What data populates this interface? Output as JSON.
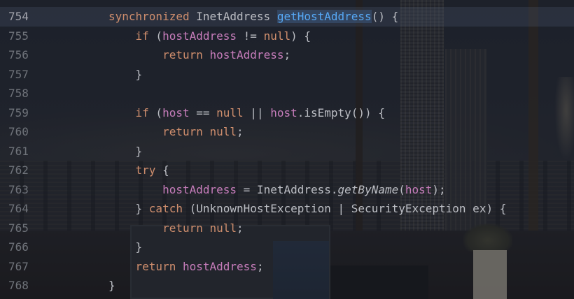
{
  "editor": {
    "lines": [
      {
        "num": "754",
        "current": true,
        "tokens": [
          {
            "t": "synchronized",
            "c": "kw"
          },
          {
            "t": " InetAddress ",
            "c": "plain"
          },
          {
            "t": "getHostAddress",
            "c": "fn-hl"
          },
          {
            "t": "() {",
            "c": "plain"
          }
        ]
      },
      {
        "num": "755",
        "tokens": [
          {
            "t": "    ",
            "c": "plain"
          },
          {
            "t": "if",
            "c": "kw"
          },
          {
            "t": " (",
            "c": "plain"
          },
          {
            "t": "hostAddress",
            "c": "fld"
          },
          {
            "t": " != ",
            "c": "plain"
          },
          {
            "t": "null",
            "c": "kw"
          },
          {
            "t": ") {",
            "c": "plain"
          }
        ]
      },
      {
        "num": "756",
        "tokens": [
          {
            "t": "        ",
            "c": "plain"
          },
          {
            "t": "return",
            "c": "kw"
          },
          {
            "t": " ",
            "c": "plain"
          },
          {
            "t": "hostAddress",
            "c": "fld"
          },
          {
            "t": ";",
            "c": "plain"
          }
        ]
      },
      {
        "num": "757",
        "tokens": [
          {
            "t": "    }",
            "c": "plain"
          }
        ]
      },
      {
        "num": "758",
        "tokens": []
      },
      {
        "num": "759",
        "tokens": [
          {
            "t": "    ",
            "c": "plain"
          },
          {
            "t": "if",
            "c": "kw"
          },
          {
            "t": " (",
            "c": "plain"
          },
          {
            "t": "host",
            "c": "fld"
          },
          {
            "t": " == ",
            "c": "plain"
          },
          {
            "t": "null",
            "c": "kw"
          },
          {
            "t": " || ",
            "c": "plain"
          },
          {
            "t": "host",
            "c": "fld"
          },
          {
            "t": ".isEmpty()) {",
            "c": "plain"
          }
        ]
      },
      {
        "num": "760",
        "tokens": [
          {
            "t": "        ",
            "c": "plain"
          },
          {
            "t": "return",
            "c": "kw"
          },
          {
            "t": " ",
            "c": "plain"
          },
          {
            "t": "null",
            "c": "kw"
          },
          {
            "t": ";",
            "c": "plain"
          }
        ]
      },
      {
        "num": "761",
        "tokens": [
          {
            "t": "    }",
            "c": "plain"
          }
        ]
      },
      {
        "num": "762",
        "tokens": [
          {
            "t": "    ",
            "c": "plain"
          },
          {
            "t": "try",
            "c": "kw"
          },
          {
            "t": " {",
            "c": "plain"
          }
        ]
      },
      {
        "num": "763",
        "tokens": [
          {
            "t": "        ",
            "c": "plain"
          },
          {
            "t": "hostAddress",
            "c": "fld"
          },
          {
            "t": " = InetAddress.",
            "c": "plain"
          },
          {
            "t": "getByName",
            "c": "static-call"
          },
          {
            "t": "(",
            "c": "plain"
          },
          {
            "t": "host",
            "c": "fld"
          },
          {
            "t": ");",
            "c": "plain"
          }
        ]
      },
      {
        "num": "764",
        "tokens": [
          {
            "t": "    } ",
            "c": "plain"
          },
          {
            "t": "catch",
            "c": "kw"
          },
          {
            "t": " (UnknownHostException | SecurityException ex) {",
            "c": "plain"
          }
        ]
      },
      {
        "num": "765",
        "tokens": [
          {
            "t": "        ",
            "c": "plain"
          },
          {
            "t": "return",
            "c": "kw"
          },
          {
            "t": " ",
            "c": "plain"
          },
          {
            "t": "null",
            "c": "kw"
          },
          {
            "t": ";",
            "c": "plain"
          }
        ]
      },
      {
        "num": "766",
        "tokens": [
          {
            "t": "    }",
            "c": "plain"
          }
        ]
      },
      {
        "num": "767",
        "tokens": [
          {
            "t": "    ",
            "c": "plain"
          },
          {
            "t": "return",
            "c": "kw"
          },
          {
            "t": " ",
            "c": "plain"
          },
          {
            "t": "hostAddress",
            "c": "fld"
          },
          {
            "t": ";",
            "c": "plain"
          }
        ]
      },
      {
        "num": "768",
        "tokens": [
          {
            "t": "}",
            "c": "plain"
          }
        ]
      }
    ]
  },
  "theme": {
    "keyword": "#cf8e6d",
    "field": "#c77dbb",
    "function": "#56a8f5",
    "text": "#bcbec4",
    "line_number": "#6f737a"
  }
}
